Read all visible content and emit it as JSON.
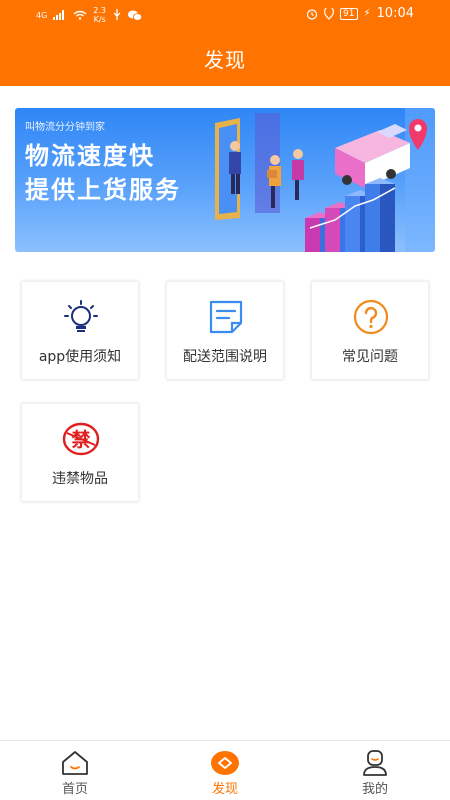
{
  "status_bar": {
    "network": "4G",
    "speed_value": "2.3",
    "speed_unit": "K/s",
    "battery": "91",
    "time": "10:04"
  },
  "header": {
    "title": "发现"
  },
  "banner": {
    "subtitle": "叫物流分分钟到家",
    "line1": "物流速度快",
    "line2": "提供上货服务"
  },
  "grid": {
    "items": [
      {
        "label": "app使用须知",
        "icon": "lightbulb-icon",
        "color": "#1b2f7a"
      },
      {
        "label": "配送范围说明",
        "icon": "document-icon",
        "color": "#3b8cf0"
      },
      {
        "label": "常见问题",
        "icon": "question-icon",
        "color": "#f28a1e"
      },
      {
        "label": "违禁物品",
        "icon": "forbidden-icon",
        "color": "#e02020"
      }
    ]
  },
  "tabbar": {
    "items": [
      {
        "label": "首页",
        "icon": "home-icon",
        "active": false
      },
      {
        "label": "发现",
        "icon": "discover-icon",
        "active": true
      },
      {
        "label": "我的",
        "icon": "profile-icon",
        "active": false
      }
    ]
  },
  "colors": {
    "accent": "#ff7300",
    "banner": "#2f86f6"
  }
}
